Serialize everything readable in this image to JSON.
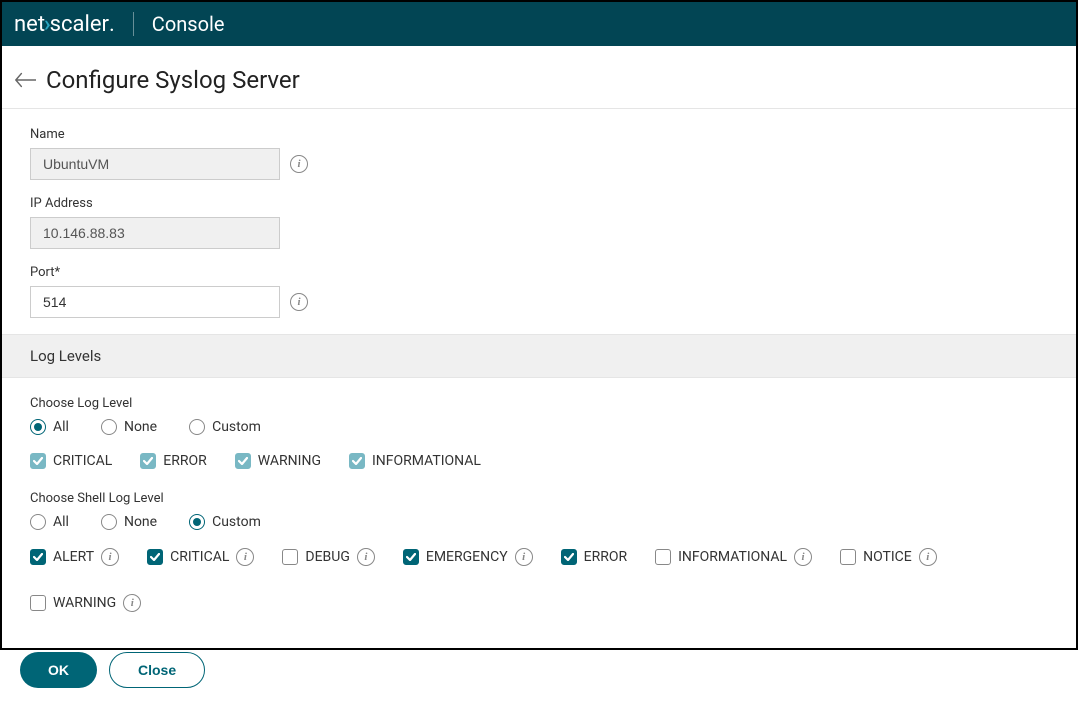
{
  "brand": {
    "net": "net",
    "scaler": "scaler",
    "dot": ".",
    "console": "Console"
  },
  "page": {
    "title": "Configure Syslog Server"
  },
  "fields": {
    "name": {
      "label": "Name",
      "value": "UbuntuVM"
    },
    "ip": {
      "label": "IP Address",
      "value": "10.146.88.83"
    },
    "port": {
      "label": "Port*",
      "value": "514"
    }
  },
  "log_section_title": "Log Levels",
  "log_level": {
    "label": "Choose Log Level",
    "options": [
      "All",
      "None",
      "Custom"
    ],
    "selected": "All",
    "flags": [
      {
        "label": "CRITICAL",
        "checked": true
      },
      {
        "label": "ERROR",
        "checked": true
      },
      {
        "label": "WARNING",
        "checked": true
      },
      {
        "label": "INFORMATIONAL",
        "checked": true
      }
    ]
  },
  "shell_log_level": {
    "label": "Choose Shell Log Level",
    "options": [
      "All",
      "None",
      "Custom"
    ],
    "selected": "Custom",
    "flags": [
      {
        "label": "ALERT",
        "checked": true,
        "info": true
      },
      {
        "label": "CRITICAL",
        "checked": true,
        "info": true
      },
      {
        "label": "DEBUG",
        "checked": false,
        "info": true
      },
      {
        "label": "EMERGENCY",
        "checked": true,
        "info": true
      },
      {
        "label": "ERROR",
        "checked": true,
        "info": false
      },
      {
        "label": "INFORMATIONAL",
        "checked": false,
        "info": true
      },
      {
        "label": "NOTICE",
        "checked": false,
        "info": true
      },
      {
        "label": "WARNING",
        "checked": false,
        "info": true
      }
    ]
  },
  "buttons": {
    "ok": "OK",
    "close": "Close"
  }
}
